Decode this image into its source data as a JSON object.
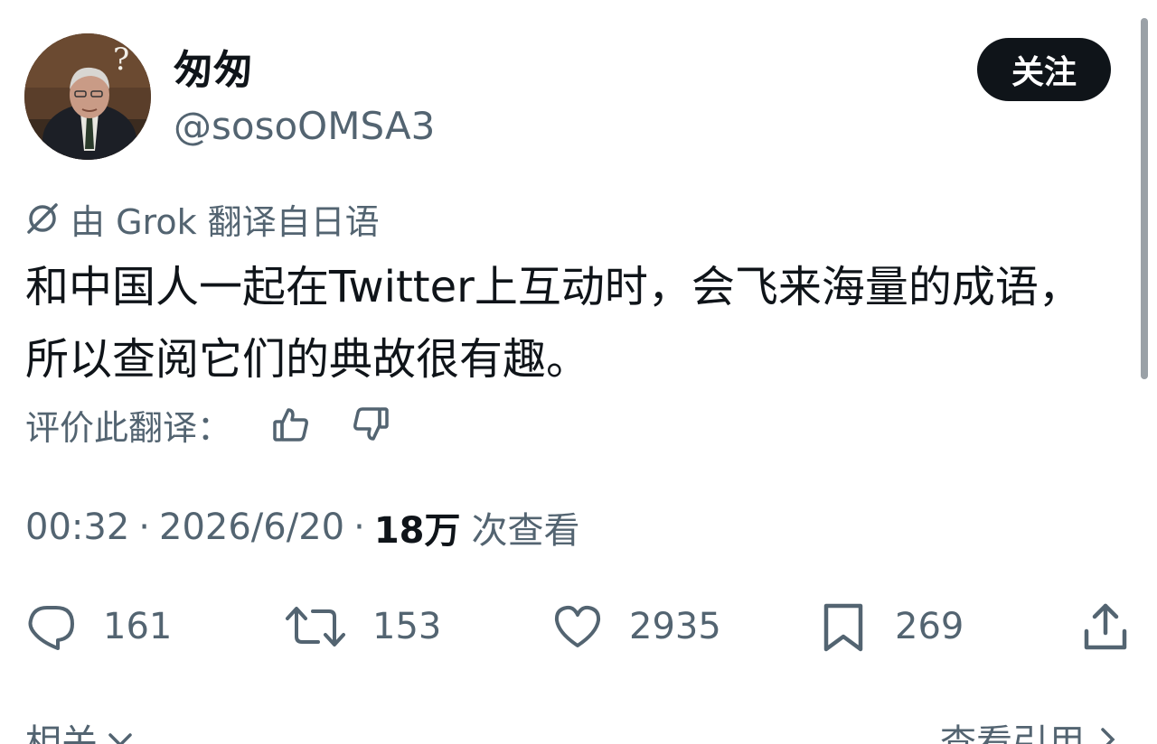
{
  "author": {
    "display_name": "匆匆",
    "handle": "@sosoOMSA3"
  },
  "follow_button": {
    "label": "关注"
  },
  "translation": {
    "note": "由 Grok 翻译自日语",
    "icon": "grok-icon"
  },
  "tweet": {
    "text": "和中国人一起在Twitter上互动时，会飞来海量的成语，所以查阅它们的典故很有趣。"
  },
  "rate_translation": {
    "label": "评价此翻译：",
    "like_icon": "thumbs-up-icon",
    "dislike_icon": "thumbs-down-icon"
  },
  "meta": {
    "time": "00:32",
    "date": "2026/6/20",
    "dot": "·",
    "views_count": "18万",
    "views_label": "次查看"
  },
  "actions": {
    "replies": "161",
    "retweets": "153",
    "likes": "2935",
    "bookmarks": "269"
  },
  "bottom": {
    "related_label": "相关",
    "view_quotes_label": "查看引用"
  }
}
